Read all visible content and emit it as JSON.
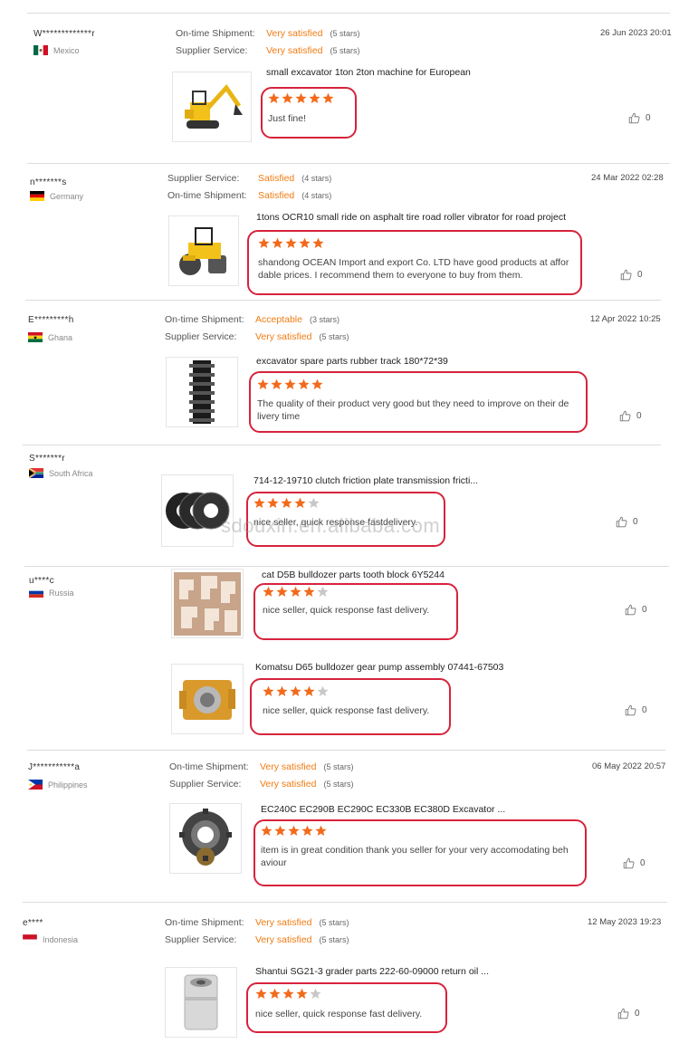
{
  "watermark": "sdouxin.en.alibaba.com",
  "reviews": [
    {
      "user": "W*************r",
      "country": "Mexico",
      "flag": "mexico",
      "date": "26 Jun 2023 20:01",
      "ratings": [
        {
          "label": "On-time Shipment:",
          "value": "Very satisfied",
          "stars": "(5 stars)"
        },
        {
          "label": "Supplier Service:",
          "value": "Very satisfied",
          "stars": "(5 stars)"
        }
      ],
      "items": [
        {
          "title": "small excavator 1ton 2ton machine for European",
          "image": "excavator-icon",
          "rating": 5,
          "comment": "Just fine!",
          "likes": "0"
        }
      ]
    },
    {
      "user": "n*******s",
      "country": "Germany",
      "flag": "germany",
      "date": "24 Mar 2022 02:28",
      "ratings": [
        {
          "label": "Supplier Service:",
          "value": "Satisfied",
          "stars": "(4 stars)"
        },
        {
          "label": "On-time Shipment:",
          "value": "Satisfied",
          "stars": "(4 stars)"
        }
      ],
      "items": [
        {
          "title": "1tons OCR10 small ride on asphalt tire road roller vibrator for road project",
          "image": "road-roller-icon",
          "rating": 5,
          "comment": "shandong OCEAN Import and export Co. LTD have good products at affor dable prices. I recommend them to everyone to buy from them.",
          "likes": "0"
        }
      ]
    },
    {
      "user": "E*********h",
      "country": "Ghana",
      "flag": "ghana",
      "date": "12 Apr 2022 10:25",
      "ratings": [
        {
          "label": "On-time Shipment:",
          "value": "Acceptable",
          "stars": "(3 stars)"
        },
        {
          "label": "Supplier Service:",
          "value": "Very satisfied",
          "stars": "(5 stars)"
        }
      ],
      "items": [
        {
          "title": "excavator spare parts rubber track 180*72*39",
          "image": "rubber-track-icon",
          "rating": 5,
          "comment": "The quality of their product very good but they need to improve on their de livery time",
          "likes": "0"
        }
      ]
    },
    {
      "user": "S*******r",
      "country": "South Africa",
      "flag": "southafrica",
      "date": "",
      "ratings": [],
      "items": [
        {
          "title": "714-12-19710 clutch friction plate transmission fricti...",
          "image": "friction-plate-icon",
          "rating": 4,
          "comment": "nice seller, quick response fastdelivery.",
          "likes": "0"
        }
      ]
    },
    {
      "user": "u****c",
      "country": "Russia",
      "flag": "russia",
      "date": "",
      "ratings": [],
      "items": [
        {
          "title": "cat D5B bulldozer parts tooth block 6Y5244",
          "image": "tooth-block-icon",
          "rating": 4,
          "comment": "nice seller, quick response fast delivery.",
          "likes": "0"
        },
        {
          "title": "Komatsu D65 bulldozer gear pump assembly 07441-67503",
          "image": "gear-pump-icon",
          "rating": 4,
          "comment": "nice seller, quick response fast delivery.",
          "likes": "0"
        }
      ]
    },
    {
      "user": "J***********a",
      "country": "Philippines",
      "flag": "philippines",
      "date": "06 May 2022 20:57",
      "ratings": [
        {
          "label": "On-time Shipment:",
          "value": "Very satisfied",
          "stars": "(5 stars)"
        },
        {
          "label": "Supplier Service:",
          "value": "Very satisfied",
          "stars": "(5 stars)"
        }
      ],
      "items": [
        {
          "title": "EC240C EC290B EC290C EC330B EC380D Excavator ...",
          "image": "ring-gear-icon",
          "rating": 5,
          "comment": "item is in great condition thank you seller for your very accomodating beh aviour",
          "likes": "0"
        }
      ]
    },
    {
      "user": "e****",
      "country": "Indonesia",
      "flag": "indonesia",
      "date": "12 May 2023 19:23",
      "ratings": [
        {
          "label": "On-time Shipment:",
          "value": "Very satisfied",
          "stars": "(5 stars)"
        },
        {
          "label": "Supplier Service:",
          "value": "Very satisfied",
          "stars": "(5 stars)"
        }
      ],
      "items": [
        {
          "title": "Shantui SG21-3 grader parts 222-60-09000 return oil ...",
          "image": "oil-filter-icon",
          "rating": 4,
          "comment": "nice seller, quick response fast delivery.",
          "likes": "0"
        }
      ]
    }
  ],
  "colors": {
    "accent": "#f07b12",
    "star_on": "#f26a1b",
    "star_off": "#c8c8c8",
    "highlight": "#d6233c"
  }
}
